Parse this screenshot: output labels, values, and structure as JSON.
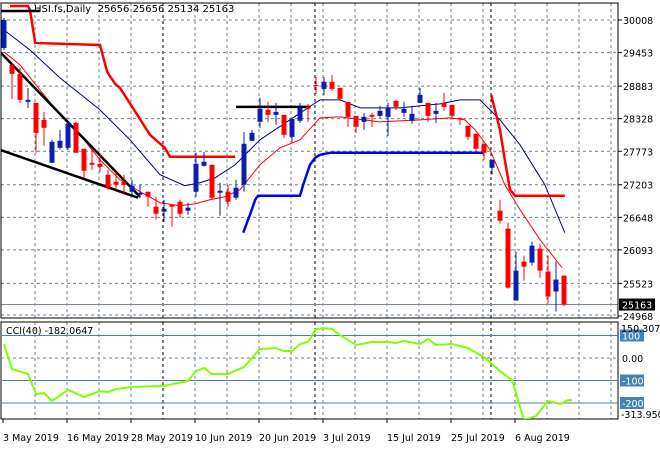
{
  "header": {
    "symbol_timeframe": "HSI.fs,Daily",
    "ohlc_text": "25656 25656 25134 25163"
  },
  "chart_data": [
    {
      "type": "candlestick",
      "title": "HSI.fs,Daily",
      "ylim": [
        24968,
        30008
      ],
      "price_ticks": [
        "30008",
        "29453",
        "28883",
        "28328",
        "27773",
        "27203",
        "26648",
        "26093",
        "25523",
        "24968"
      ],
      "current_price": "25163",
      "x_tick_labels": [
        {
          "index": 0,
          "label": "3 May 2019"
        },
        {
          "index": 8,
          "label": "16 May 2019"
        },
        {
          "index": 16,
          "label": "28 May 2019"
        },
        {
          "index": 24,
          "label": "10 Jun 2019"
        },
        {
          "index": 32,
          "label": "20 Jun 2019"
        },
        {
          "index": 40,
          "label": "3 Jul 2019"
        },
        {
          "index": 48,
          "label": "15 Jul 2019"
        },
        {
          "index": 56,
          "label": "25 Jul 2019"
        },
        {
          "index": 64,
          "label": "6 Aug 2019"
        }
      ],
      "period_separators": [
        20,
        39,
        61
      ],
      "candles_ohlc": [
        [
          29532,
          30042,
          29498,
          30008
        ],
        [
          29243,
          29243,
          28665,
          29090
        ],
        [
          29090,
          29192,
          28597,
          28648
        ],
        [
          28614,
          28852,
          28512,
          28648
        ],
        [
          28597,
          28597,
          27747,
          28087
        ],
        [
          28308,
          28444,
          27866,
          28172
        ],
        [
          27577,
          27968,
          27577,
          27934
        ],
        [
          27832,
          28138,
          27798,
          27951
        ],
        [
          27832,
          28274,
          27798,
          28240
        ],
        [
          28257,
          28274,
          27747,
          27747
        ],
        [
          27815,
          27815,
          27322,
          27441
        ],
        [
          27577,
          27832,
          27458,
          27543
        ],
        [
          27560,
          27747,
          27424,
          27509
        ],
        [
          27373,
          27458,
          27118,
          27152
        ],
        [
          27254,
          27424,
          27118,
          27203
        ],
        [
          27254,
          27373,
          27033,
          27203
        ],
        [
          27084,
          27288,
          27033,
          27186
        ],
        [
          27033,
          27203,
          26982,
          27067
        ],
        [
          27084,
          27084,
          26829,
          26999
        ],
        [
          26829,
          26999,
          26608,
          26710
        ],
        [
          26744,
          26948,
          26574,
          26795
        ],
        [
          26863,
          26863,
          26489,
          26829
        ],
        [
          26914,
          26948,
          26642,
          26710
        ],
        [
          26761,
          26897,
          26693,
          26812
        ],
        [
          27084,
          27747,
          26999,
          27560
        ],
        [
          27526,
          27764,
          27509,
          27594
        ],
        [
          27543,
          27543,
          26948,
          26982
        ],
        [
          27067,
          27237,
          26676,
          27101
        ],
        [
          27084,
          27203,
          26829,
          26914
        ],
        [
          26982,
          27288,
          26948,
          27152
        ],
        [
          27203,
          28104,
          27084,
          27900
        ],
        [
          27951,
          28138,
          27951,
          28087
        ],
        [
          28274,
          28682,
          28172,
          28495
        ],
        [
          28478,
          28614,
          28274,
          28393
        ],
        [
          28393,
          28597,
          28223,
          28444
        ],
        [
          28393,
          28393,
          28002,
          28053
        ],
        [
          28019,
          28325,
          27934,
          28325
        ],
        [
          28291,
          28597,
          28257,
          28512
        ],
        [
          28529,
          28580,
          28274,
          28495
        ],
        [
          28903,
          29039,
          28750,
          28886
        ],
        [
          28835,
          29039,
          28733,
          28954
        ],
        [
          28954,
          29073,
          28801,
          28835
        ],
        [
          28852,
          28852,
          28631,
          28665
        ],
        [
          28614,
          28614,
          28189,
          28359
        ],
        [
          28376,
          28376,
          28087,
          28189
        ],
        [
          28274,
          28427,
          28138,
          28359
        ],
        [
          28393,
          28427,
          28189,
          28359
        ],
        [
          28376,
          28546,
          28342,
          28461
        ],
        [
          28359,
          28597,
          28036,
          28512
        ],
        [
          28631,
          28648,
          28478,
          28529
        ],
        [
          28427,
          28614,
          28359,
          28495
        ],
        [
          28291,
          28546,
          28240,
          28410
        ],
        [
          28597,
          28852,
          28597,
          28733
        ],
        [
          28597,
          28597,
          28274,
          28376
        ],
        [
          28410,
          28597,
          28257,
          28461
        ],
        [
          28597,
          28767,
          28461,
          28529
        ],
        [
          28563,
          28563,
          28342,
          28376
        ],
        [
          28342,
          28342,
          28223,
          28325
        ],
        [
          28206,
          28206,
          27968,
          28019
        ],
        [
          28070,
          28070,
          27781,
          27815
        ],
        [
          27900,
          27900,
          27628,
          27747
        ],
        [
          27492,
          27628,
          27373,
          27628
        ],
        [
          26761,
          26948,
          26540,
          26591
        ],
        [
          26455,
          26557,
          25435,
          25452
        ],
        [
          25231,
          26064,
          25231,
          25741
        ],
        [
          25894,
          25996,
          25571,
          25809
        ],
        [
          25877,
          26234,
          25826,
          26166
        ],
        [
          26115,
          26200,
          25622,
          25741
        ],
        [
          25724,
          25996,
          25180,
          25299
        ],
        [
          25384,
          25894,
          25044,
          25588
        ],
        [
          25656,
          25656,
          25134,
          25163
        ]
      ],
      "series": [
        {
          "name": "ma-fast-red",
          "color": "#ff0000",
          "points": [
            [
              0,
              29464
            ],
            [
              2,
              29243
            ],
            [
              4.5,
              28818
            ],
            [
              7,
              28393
            ],
            [
              9.5,
              28053
            ],
            [
              12,
              27628
            ],
            [
              14.5,
              27288
            ],
            [
              17,
              27084
            ],
            [
              19.5,
              26897
            ],
            [
              22,
              26846
            ],
            [
              23.9,
              26880
            ],
            [
              25.75,
              26948
            ],
            [
              27.6,
              26999
            ],
            [
              29.5,
              27118
            ],
            [
              32,
              27543
            ],
            [
              34.5,
              27832
            ],
            [
              37,
              27968
            ],
            [
              39.5,
              28342
            ],
            [
              42,
              28359
            ],
            [
              47,
              28274
            ],
            [
              52,
              28308
            ],
            [
              55.75,
              28342
            ],
            [
              57.6,
              28308
            ],
            [
              58.9,
              28138
            ],
            [
              60.75,
              27798
            ],
            [
              62.6,
              27203
            ],
            [
              64.5,
              26778
            ],
            [
              67,
              26268
            ],
            [
              69.75,
              25792
            ]
          ]
        },
        {
          "name": "ma-slow-navy",
          "color": "#000080",
          "points": [
            [
              0,
              29838
            ],
            [
              3.25,
              29498
            ],
            [
              7,
              29022
            ],
            [
              12,
              28478
            ],
            [
              15.75,
              27968
            ],
            [
              19.5,
              27373
            ],
            [
              22.6,
              27186
            ],
            [
              24.5,
              27237
            ],
            [
              26.4,
              27322
            ],
            [
              28.9,
              27543
            ],
            [
              32,
              27968
            ],
            [
              35.75,
              28308
            ],
            [
              39.5,
              28648
            ],
            [
              42,
              28648
            ],
            [
              44.5,
              28512
            ],
            [
              49.5,
              28512
            ],
            [
              54.5,
              28580
            ],
            [
              57,
              28648
            ],
            [
              59.5,
              28648
            ],
            [
              62,
              28308
            ],
            [
              64.5,
              27883
            ],
            [
              67.6,
              27203
            ],
            [
              70.1,
              26387
            ]
          ]
        },
        {
          "name": "resistance-step-red-1",
          "color": "#ff0000",
          "points": [
            [
              0.75,
              30246
            ],
            [
              3,
              30246
            ],
            [
              3.25,
              30178
            ],
            [
              3.9,
              29617
            ],
            [
              12,
              29583
            ],
            [
              12.9,
              29124
            ],
            [
              13.9,
              28920
            ],
            [
              14.5,
              28852
            ],
            [
              18.25,
              28053
            ],
            [
              20.1,
              27832
            ],
            [
              20.75,
              27679
            ],
            [
              28.9,
              27679
            ]
          ]
        },
        {
          "name": "resistance-step-red-2",
          "color": "#ff0000",
          "points": [
            [
              60.9,
              28733
            ],
            [
              62,
              28138
            ],
            [
              62.6,
              27628
            ],
            [
              63.25,
              27118
            ],
            [
              63.9,
              27016
            ],
            [
              70.1,
              27016
            ]
          ]
        },
        {
          "name": "support-step-blue",
          "color": "#0000ff",
          "points": [
            [
              29.9,
              26387
            ],
            [
              30.75,
              26693
            ],
            [
              31.4,
              26948
            ],
            [
              31.75,
              27016
            ],
            [
              37,
              27016
            ],
            [
              37.4,
              27203
            ],
            [
              38.25,
              27543
            ],
            [
              38.9,
              27662
            ],
            [
              39.5,
              27713
            ],
            [
              40.75,
              27747
            ],
            [
              59.9,
              27747
            ]
          ]
        }
      ],
      "trendlines": [
        {
          "name": "downtrend-upper",
          "points": [
            [
              -0.5,
              29464
            ],
            [
              17,
              26999
            ]
          ]
        },
        {
          "name": "downtrend-lower",
          "points": [
            [
              -0.5,
              27798
            ],
            [
              16.75,
              26982
            ]
          ]
        },
        {
          "name": "horizontal-level",
          "points": [
            [
              29,
              28529
            ],
            [
              38.25,
              28529
            ]
          ]
        },
        {
          "name": "top-level",
          "points": [
            [
              -0.5,
              30161
            ],
            [
              4.5,
              30161
            ]
          ]
        }
      ],
      "colors": {
        "up": "#0a1eb4",
        "down": "#ff0000",
        "grid": "#708090",
        "separator": "#000000"
      }
    },
    {
      "type": "line",
      "title": "CCI(40) -182.0647",
      "indicator_label": "CCI(40) -182.0647",
      "ylim": [
        -271,
        160
      ],
      "scale_max_label": "150.3071",
      "scale_min_label": "-313.950",
      "levels": [
        {
          "value": 100,
          "label": "100"
        },
        {
          "value": -100,
          "label": "-100"
        },
        {
          "value": -200,
          "label": "-200"
        }
      ],
      "zero_label": "0.00",
      "color": "#7fff00",
      "level_color": "#4682b4",
      "points": [
        [
          0,
          62
        ],
        [
          1,
          -49
        ],
        [
          3,
          -71
        ],
        [
          4,
          -160
        ],
        [
          5,
          -156
        ],
        [
          6,
          -191
        ],
        [
          8,
          -142
        ],
        [
          10,
          -173
        ],
        [
          12,
          -147
        ],
        [
          13,
          -151
        ],
        [
          14,
          -138
        ],
        [
          16,
          -129
        ],
        [
          20,
          -124
        ],
        [
          23,
          -102
        ],
        [
          24,
          -58
        ],
        [
          25,
          -44
        ],
        [
          26,
          -71
        ],
        [
          28,
          -71
        ],
        [
          30,
          -40
        ],
        [
          32,
          40
        ],
        [
          34,
          44
        ],
        [
          35,
          31
        ],
        [
          36,
          31
        ],
        [
          37,
          62
        ],
        [
          38,
          71
        ],
        [
          39,
          129
        ],
        [
          40,
          133
        ],
        [
          41,
          129
        ],
        [
          42,
          102
        ],
        [
          44,
          58
        ],
        [
          46,
          71
        ],
        [
          48,
          71
        ],
        [
          49,
          67
        ],
        [
          50,
          76
        ],
        [
          52,
          62
        ],
        [
          53,
          84
        ],
        [
          54,
          58
        ],
        [
          56,
          62
        ],
        [
          58,
          44
        ],
        [
          60,
          4
        ],
        [
          62,
          -58
        ],
        [
          63.5,
          -98
        ],
        [
          65,
          -276
        ],
        [
          66.5,
          -258
        ],
        [
          68,
          -191
        ],
        [
          69.5,
          -204
        ],
        [
          70.5,
          -187
        ],
        [
          71,
          -187
        ]
      ]
    }
  ]
}
